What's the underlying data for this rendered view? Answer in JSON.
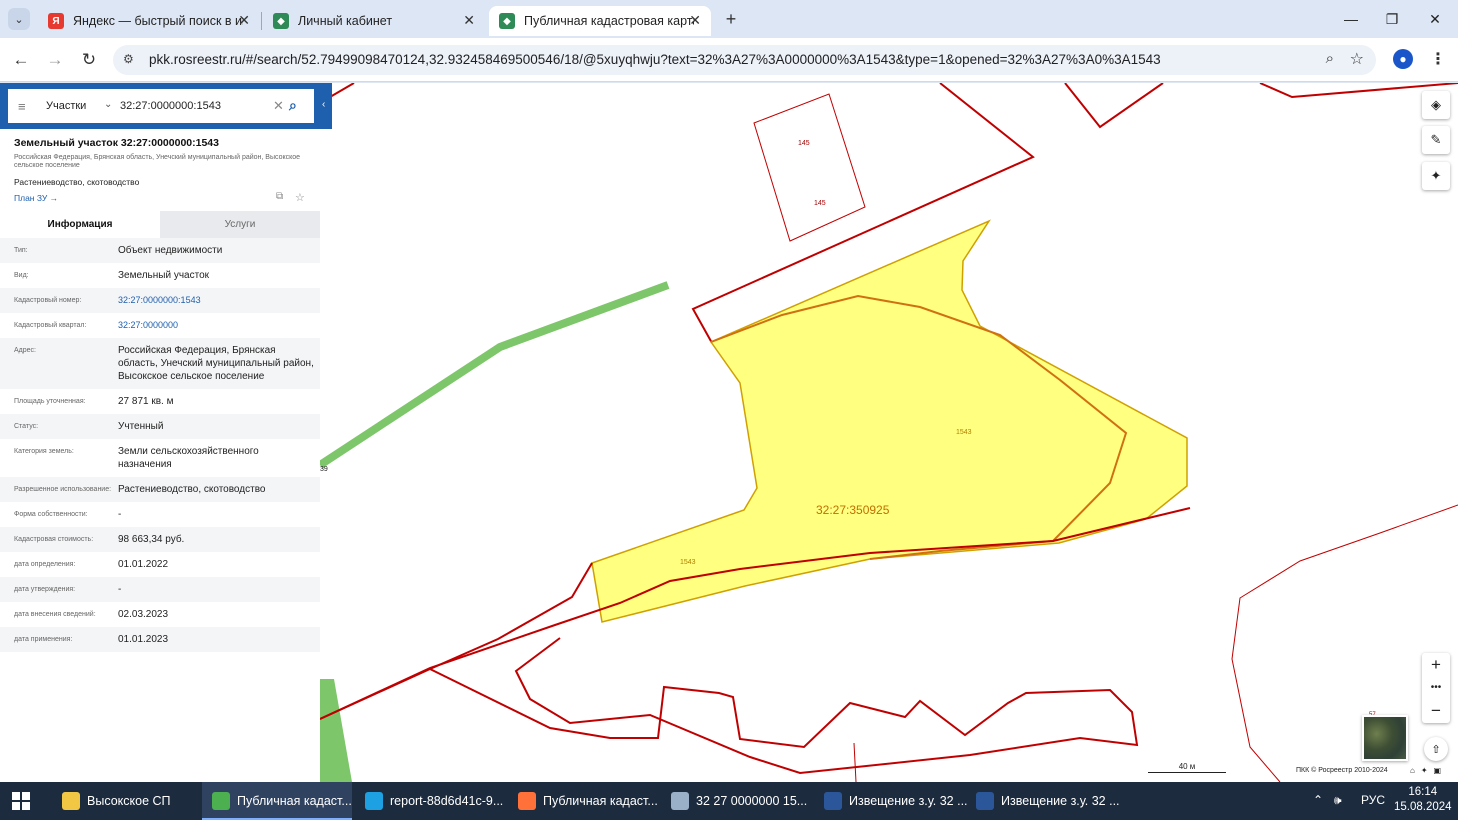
{
  "browser": {
    "tabs": [
      {
        "title": "Яндекс — быстрый поиск в ин",
        "favicon": "yandex-icon",
        "color": "#e63a30"
      },
      {
        "title": "Личный кабинет",
        "favicon": "rosreestr-icon",
        "color": "#2e8b57"
      },
      {
        "title": "Публичная кадастровая карта",
        "favicon": "rosreestr-icon",
        "color": "#2e8b57"
      }
    ],
    "url": "pkk.rosreestr.ru/#/search/52.79499098470124,32.932458469500546/18/@5xuyqhwju?text=32%3A27%3A0000000%3A1543&type=1&opened=32%3A27%3A0%3A1543"
  },
  "search": {
    "category": "Участки",
    "query": "32:27:0000000:1543"
  },
  "object": {
    "title": "Земельный участок 32:27:0000000:1543",
    "address_short": "Российская Федерация, Брянская область, Унечский муниципальный район, Высокское сельское поселение",
    "use": "Растениеводство, скотоводство",
    "plan_link": "План ЗУ →"
  },
  "info_tabs": [
    "Информация",
    "Услуги"
  ],
  "properties": [
    {
      "key": "Тип:",
      "value": "Объект недвижимости"
    },
    {
      "key": "Вид:",
      "value": "Земельный участок"
    },
    {
      "key": "Кадастровый номер:",
      "value": "32:27:0000000:1543",
      "link": true
    },
    {
      "key": "Кадастровый квартал:",
      "value": "32:27:0000000",
      "link": true
    },
    {
      "key": "Адрес:",
      "value": "Российская Федерация, Брянская область, Унечский муниципальный район, Высокское сельское поселение"
    },
    {
      "key": "Площадь уточненная:",
      "value": "27 871 кв. м"
    },
    {
      "key": "Статус:",
      "value": "Учтенный"
    },
    {
      "key": "Категория земель:",
      "value": "Земли сельскохозяйственного назначения"
    },
    {
      "key": "Разрешенное использование:",
      "value": "Растениеводство, скотоводство"
    },
    {
      "key": "Форма собственности:",
      "value": "-"
    },
    {
      "key": "Кадастровая стоимость:",
      "value": "98 663,34 руб."
    },
    {
      "key": "дата определения:",
      "value": "01.01.2022"
    },
    {
      "key": "дата утверждения:",
      "value": "-"
    },
    {
      "key": "дата внесения сведений:",
      "value": "02.03.2023"
    },
    {
      "key": "дата применения:",
      "value": "01.01.2023"
    }
  ],
  "map": {
    "labels": {
      "quarter": "32:27:350925",
      "parcel_a": "1543",
      "parcel_b": "1543",
      "small_a": "145",
      "small_b": "145",
      "edge": "39",
      "corner": "57"
    },
    "scale": "40 м",
    "copyright": "ПКК © Росреестр 2010-2024",
    "colors": {
      "parcel_fill": "#ffff80",
      "boundary": "#c00000",
      "road": "#7dc66a"
    }
  },
  "taskbar": {
    "items": [
      {
        "label": "Высокское СП",
        "icon": "folder-icon",
        "color": "#f2c744"
      },
      {
        "label": "Публичная кадаст...",
        "icon": "chrome-icon",
        "color": "#4caf50",
        "active": true
      },
      {
        "label": "report-88d6d41c-9...",
        "icon": "edge-icon",
        "color": "#1da1e2"
      },
      {
        "label": "Публичная кадаст...",
        "icon": "firefox-icon",
        "color": "#ff7139"
      },
      {
        "label": "32  27  0000000  15...",
        "icon": "paint-icon",
        "color": "#9ab0c8"
      },
      {
        "label": "Извещение з.у. 32 ...",
        "icon": "word-icon",
        "color": "#2b579a"
      },
      {
        "label": "Извещение з.у. 32 ...",
        "icon": "word-icon",
        "color": "#2b579a"
      }
    ],
    "lang": "РУС",
    "time": "16:14",
    "date": "15.08.2024"
  }
}
